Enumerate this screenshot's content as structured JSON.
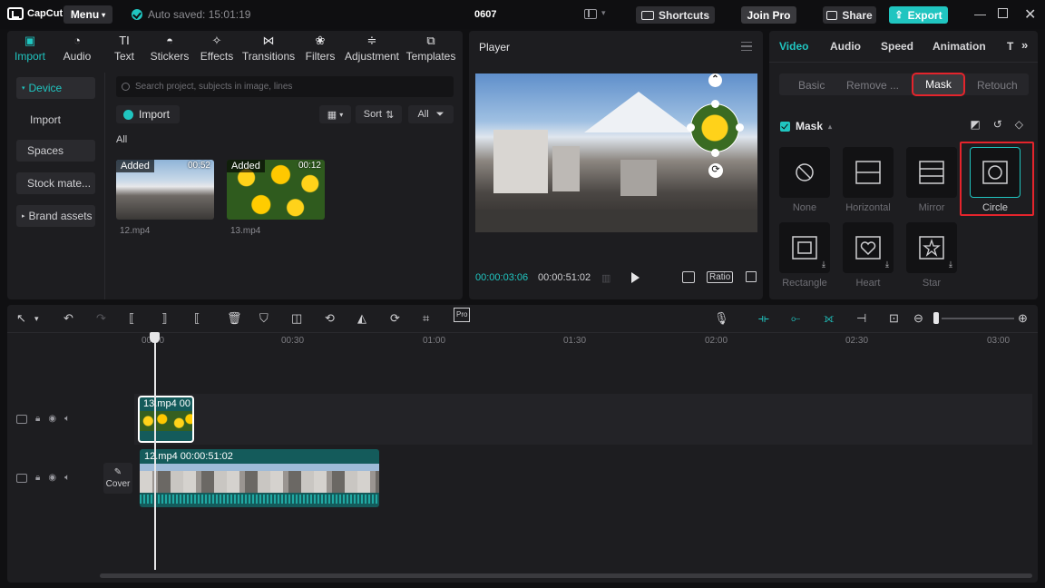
{
  "titlebar": {
    "app_name": "CapCut",
    "menu_label": "Menu",
    "autosave_text": "Auto saved: 15:01:19",
    "project_title": "0607",
    "shortcuts_label": "Shortcuts",
    "join_pro_label": "Join Pro",
    "share_label": "Share",
    "export_label": "Export"
  },
  "colors": {
    "accent": "#20c5c0",
    "highlight": "#e4242c",
    "background": "#101012",
    "panel": "#1d1d20"
  },
  "media": {
    "tools": [
      {
        "label": "Import",
        "icon": "import-icon",
        "active": true
      },
      {
        "label": "Audio",
        "icon": "audio-icon",
        "active": false
      },
      {
        "label": "Text",
        "icon": "text-icon",
        "active": false
      },
      {
        "label": "Stickers",
        "icon": "stickers-icon",
        "active": false
      },
      {
        "label": "Effects",
        "icon": "effects-icon",
        "active": false
      },
      {
        "label": "Transitions",
        "icon": "transitions-icon",
        "active": false
      },
      {
        "label": "Filters",
        "icon": "filters-icon",
        "active": false
      },
      {
        "label": "Adjustment",
        "icon": "adjustment-icon",
        "active": false
      },
      {
        "label": "Templates",
        "icon": "templates-icon",
        "active": false
      }
    ],
    "sidebar": {
      "device": "Device",
      "import": "Import",
      "spaces": "Spaces",
      "stock": "Stock mate...",
      "brand": "Brand assets"
    },
    "search_placeholder": "Search project, subjects in image, lines",
    "import_button": "Import",
    "sort_label": "Sort",
    "filter_label": "All",
    "all_label": "All",
    "clips": [
      {
        "name": "12.mp4",
        "tag": "Added",
        "duration": "00:52"
      },
      {
        "name": "13.mp4",
        "tag": "Added",
        "duration": "00:12"
      }
    ]
  },
  "player": {
    "title": "Player",
    "current_time": "00:00:03:06",
    "total_time": "00:00:51:02",
    "ratio_label": "Ratio"
  },
  "props": {
    "tabs": [
      "Video",
      "Audio",
      "Speed",
      "Animation",
      "T"
    ],
    "subtabs": [
      "Basic",
      "Remove ...",
      "Mask",
      "Retouch"
    ],
    "mask_title": "Mask",
    "masks": [
      {
        "label": "None",
        "icon": "none-mask-icon"
      },
      {
        "label": "Horizontal",
        "icon": "horizontal-mask-icon"
      },
      {
        "label": "Mirror",
        "icon": "mirror-mask-icon"
      },
      {
        "label": "Circle",
        "icon": "circle-mask-icon"
      },
      {
        "label": "Rectangle",
        "icon": "rectangle-mask-icon"
      },
      {
        "label": "Heart",
        "icon": "heart-mask-icon"
      },
      {
        "label": "Star",
        "icon": "star-mask-icon"
      }
    ],
    "selected_mask": "Circle"
  },
  "timeline": {
    "ruler": [
      "00:00",
      "00:30",
      "01:00",
      "01:30",
      "02:00",
      "02:30",
      "03:00"
    ],
    "overlay_clip_label": "13.mp4  00",
    "main_clip_label": "12.mp4  00:00:51:02",
    "cover_label": "Cover"
  }
}
